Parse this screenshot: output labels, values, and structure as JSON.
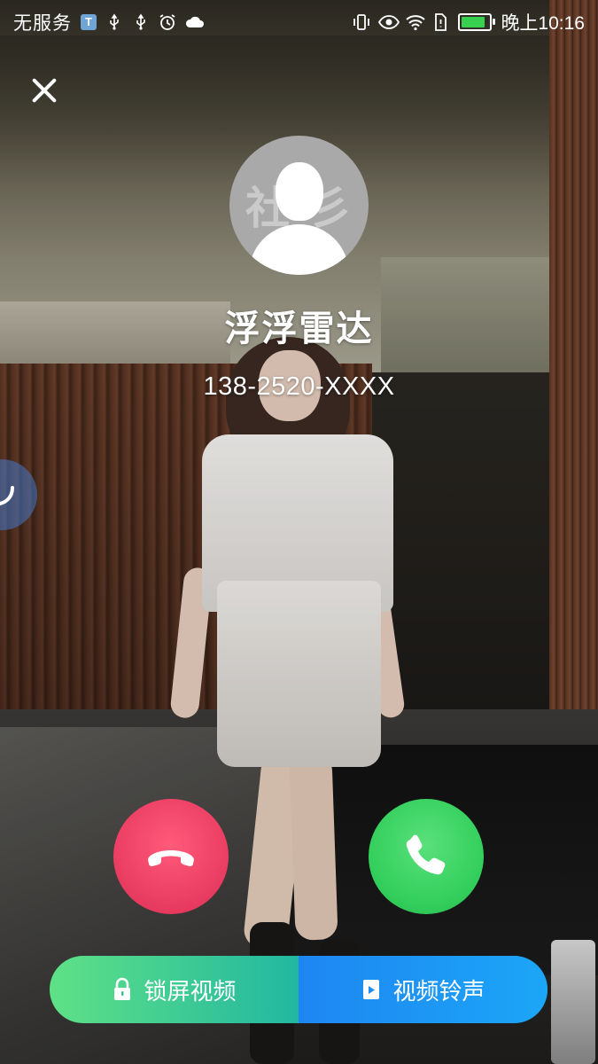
{
  "status_bar": {
    "carrier": "无服务",
    "left_icons": [
      "t-app-icon",
      "usb-icon",
      "usb-icon",
      "alarm-icon",
      "cloud-icon"
    ],
    "right_icons": [
      "vibrate-icon",
      "eye-icon",
      "wifi-icon",
      "sim-icon"
    ],
    "battery_level": 0.85,
    "battery_color": "#37d14f",
    "time": "晚上10:16"
  },
  "call": {
    "caller_name": "浮浮雷达",
    "caller_number": "138-2520-XXXX",
    "avatar_watermark": [
      "社",
      "彡"
    ],
    "decline_color": "#ea3d62",
    "accept_color": "#33cf5c"
  },
  "bottom_bar": {
    "lock_screen_video_label": "锁屏视频",
    "video_ringtone_label": "视频铃声"
  }
}
